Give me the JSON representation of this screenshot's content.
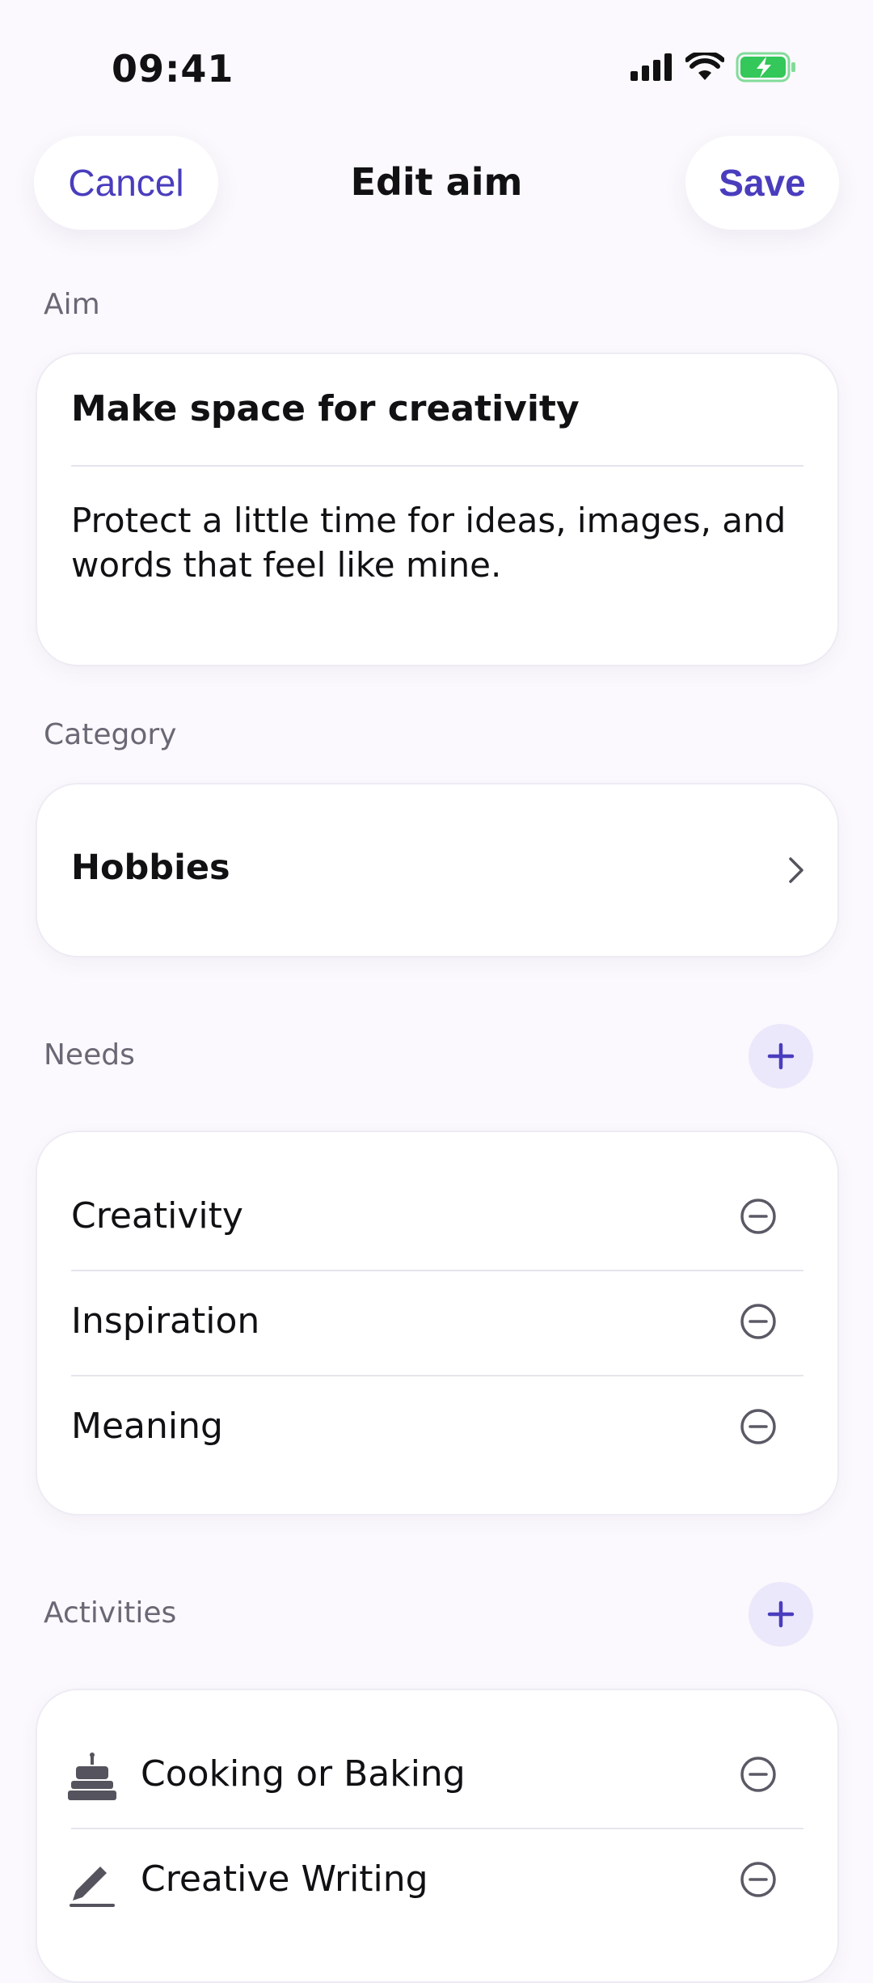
{
  "status_bar": {
    "time": "09:41"
  },
  "nav": {
    "cancel_label": "Cancel",
    "title": "Edit aim",
    "save_label": "Save"
  },
  "aim": {
    "label": "Aim",
    "title": "Make space for creativity",
    "description": "Protect a little time for ideas, images, and words that feel like mine."
  },
  "category": {
    "label": "Category",
    "value": "Hobbies"
  },
  "needs": {
    "label": "Needs",
    "items": [
      {
        "label": "Creativity"
      },
      {
        "label": "Inspiration"
      },
      {
        "label": "Meaning"
      }
    ]
  },
  "activities": {
    "label": "Activities",
    "items": [
      {
        "label": "Cooking or Baking",
        "icon": "cake-icon"
      },
      {
        "label": "Creative Writing",
        "icon": "pencil-icon"
      }
    ]
  },
  "colors": {
    "accent": "#4a3dbd",
    "background": "#fbf9fd",
    "plus_bg": "#ece8fb",
    "battery": "#34c759"
  }
}
